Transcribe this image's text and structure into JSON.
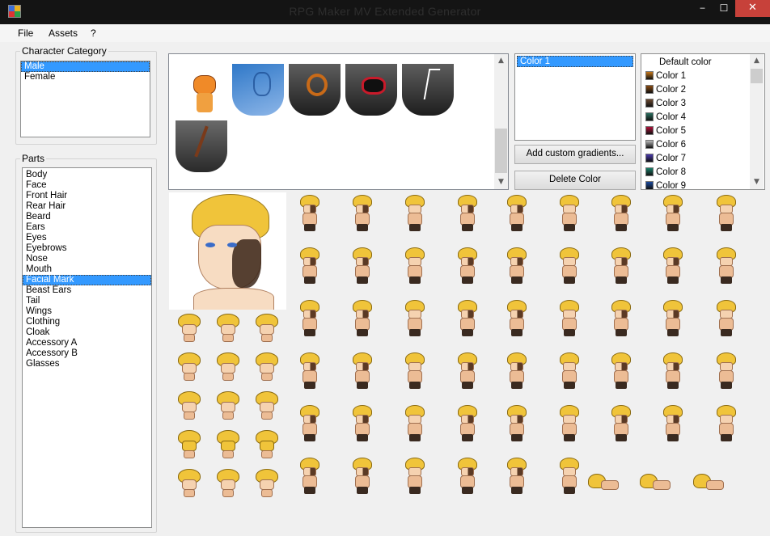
{
  "window": {
    "title": "RPG Maker MV Extended Generator",
    "controls": {
      "minimize": "‒",
      "maximize": "☐",
      "close": "✕"
    }
  },
  "menu": [
    "File",
    "Assets",
    "?"
  ],
  "category": {
    "legend": "Character Category",
    "items": [
      "Male",
      "Female"
    ],
    "selected": "Male"
  },
  "parts": {
    "legend": "Parts",
    "items": [
      "Body",
      "Face",
      "Front Hair",
      "Rear Hair",
      "Beard",
      "Ears",
      "Eyes",
      "Eyebrows",
      "Nose",
      "Mouth",
      "Facial Mark",
      "Beast Ears",
      "Tail",
      "Wings",
      "Clothing",
      "Cloak",
      "Accessory A",
      "Accessory B",
      "Glasses"
    ],
    "selected": "Facial Mark"
  },
  "gradients": {
    "items": [
      "Color 1"
    ],
    "selected": "Color 1",
    "add_button": "Add custom gradients...",
    "delete_button": "Delete Color"
  },
  "colors": {
    "items": [
      {
        "label": "Default color",
        "swatch": ""
      },
      {
        "label": "Color 1",
        "swatch": "#c8781a"
      },
      {
        "label": "Color 2",
        "swatch": "#8a4a10"
      },
      {
        "label": "Color 3",
        "swatch": "#6b4a30"
      },
      {
        "label": "Color 4",
        "swatch": "#2a7060"
      },
      {
        "label": "Color 5",
        "swatch": "#b0103a"
      },
      {
        "label": "Color 6",
        "swatch": "#bcbcbc"
      },
      {
        "label": "Color 7",
        "swatch": "#4a3ab0"
      },
      {
        "label": "Color 8",
        "swatch": "#18806a"
      },
      {
        "label": "Color 9",
        "swatch": "#1a4aa0"
      }
    ]
  },
  "facial_marks": [
    "fox-mask",
    "blue-bird-tattoo",
    "orange-dragon-tattoo",
    "red-tribal-tattoo",
    "white-rune-mark",
    "scar-mark"
  ],
  "theme": {
    "selection": "#3399ff",
    "close_button": "#c7413a",
    "hair": "#f0c43a",
    "skin": "#f5d2b0"
  }
}
